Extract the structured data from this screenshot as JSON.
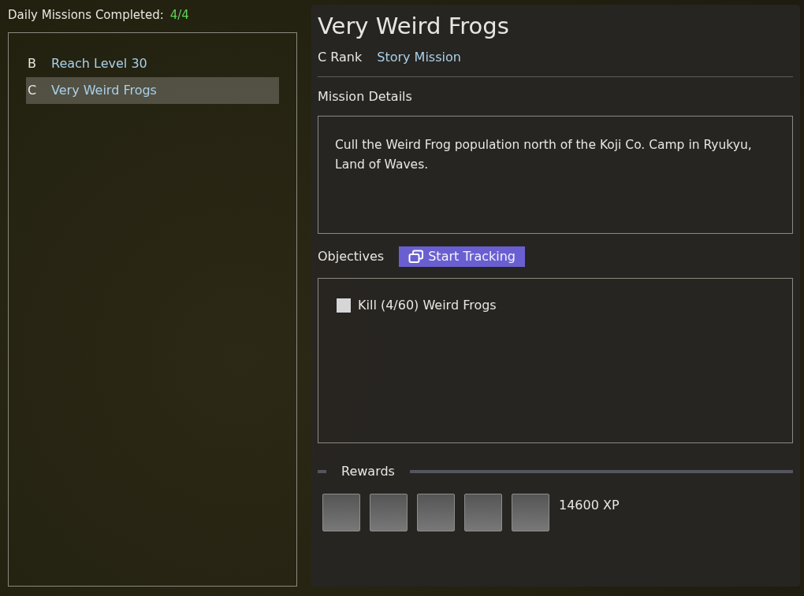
{
  "daily": {
    "label": "Daily Missions Completed:",
    "count": "4/4"
  },
  "missions": [
    {
      "rank": "B",
      "title": "Reach Level 30",
      "selected": false
    },
    {
      "rank": "C",
      "title": "Very Weird Frogs",
      "selected": true
    }
  ],
  "detail": {
    "title": "Very Weird Frogs",
    "rank": "C Rank",
    "type": "Story Mission",
    "details_heading": "Mission Details",
    "description": "Cull the Weird Frog population north of the Koji Co. Camp in Ryukyu, Land of Waves.",
    "objectives_heading": "Objectives",
    "track_button": "Start Tracking",
    "objectives": [
      {
        "text": "Kill (4/60) Weird Frogs",
        "checked": false
      }
    ],
    "rewards_heading": "Rewards",
    "reward_slots": [
      {
        "empty": true
      },
      {
        "empty": true
      },
      {
        "empty": true
      },
      {
        "empty": true
      },
      {
        "empty": true
      }
    ],
    "reward_xp": "14600 XP"
  }
}
